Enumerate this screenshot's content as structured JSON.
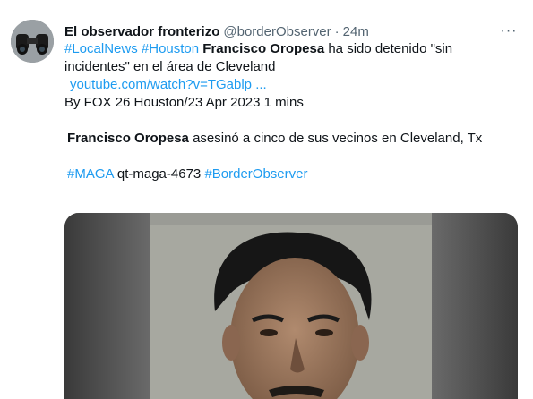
{
  "tweet": {
    "display_name": "El observador fronterizo",
    "handle": "@borderObserver",
    "separator": "·",
    "time": "24m",
    "more_label": "···",
    "line1": {
      "tag1": "#LocalNews",
      "tag2": "#Houston",
      "bold": "Francisco Oropesa",
      "rest": "ha sido detenido \"sin"
    },
    "line2": "incidentes\" en el área de Cleveland",
    "link": "youtube.com/watch?v=TGablp ...",
    "byline": "By FOX 26 Houston/23 Apr 2023 1 mins",
    "para2": {
      "bold": "Francisco Oropesa",
      "rest": "asesinó a cinco de sus vecinos en Cleveland, Tx"
    },
    "tags_line": {
      "tag1": "#MAGA",
      "middle": "qt-maga-4673",
      "tag2": "#BorderObserver"
    }
  },
  "colors": {
    "link": "#1d9bf0",
    "text": "#0f1419",
    "secondary": "#536471"
  },
  "media": {
    "description_icon": "mugshot-photo"
  }
}
